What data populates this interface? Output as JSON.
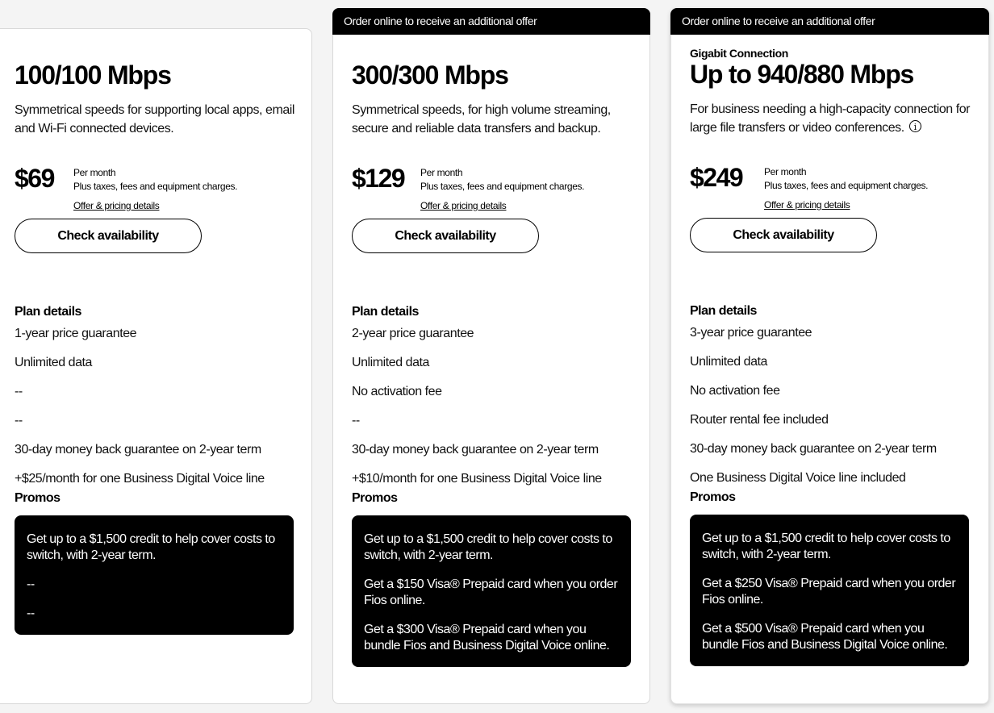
{
  "plans": [
    {
      "banner": "",
      "eyebrow": "",
      "speed": "100/100 Mbps",
      "description": "Symmetrical speeds for supporting local apps, email and Wi-Fi connected devices.",
      "price": "$69",
      "price_period": "Per month",
      "price_note": "Plus taxes, fees and equipment charges.",
      "offer_link": "Offer & pricing details",
      "cta": "Check availability",
      "details_title": "Plan details",
      "details": [
        "1-year price guarantee",
        "Unlimited data",
        "--",
        "--",
        "30-day money back guarantee on 2-year term",
        "+$25/month for one Business Digital Voice line"
      ],
      "promos_title": "Promos",
      "promos": [
        "Get up to a $1,500 credit to help cover costs to switch, with 2-year term.",
        "--",
        "--"
      ]
    },
    {
      "banner": "Order online to receive an additional offer",
      "eyebrow": "",
      "speed": "300/300 Mbps",
      "description": "Symmetrical speeds, for high volume streaming, secure and reliable data transfers and backup.",
      "price": "$129",
      "price_period": "Per month",
      "price_note": "Plus taxes, fees and equipment charges.",
      "offer_link": "Offer & pricing details",
      "cta": "Check availability",
      "details_title": "Plan details",
      "details": [
        "2-year price guarantee",
        "Unlimited data",
        "No activation fee",
        "--",
        "30-day money back guarantee on 2-year term",
        "+$10/month for one Business Digital Voice line"
      ],
      "promos_title": "Promos",
      "promos": [
        "Get up to a $1,500 credit to help cover costs to switch, with 2-year term.",
        "Get a $150 Visa® Prepaid card when you order Fios online.",
        "Get a $300 Visa® Prepaid card when you bundle Fios and Business Digital Voice online."
      ]
    },
    {
      "banner": "Order online to receive an additional offer",
      "eyebrow": "Gigabit Connection",
      "speed": "Up to 940/880 Mbps",
      "description": "For business needing a high-capacity connection for large file transfers or video conferences.",
      "info_icon": "i",
      "price": "$249",
      "price_period": "Per month",
      "price_note": "Plus taxes, fees and equipment charges.",
      "offer_link": "Offer & pricing details",
      "cta": "Check availability",
      "details_title": "Plan details",
      "details": [
        "3-year price guarantee",
        "Unlimited data",
        "No activation fee",
        "Router rental fee included",
        "30-day money back guarantee on 2-year term",
        "One Business Digital Voice line included"
      ],
      "promos_title": "Promos",
      "promos": [
        "Get up to a $1,500 credit to help cover costs to switch, with 2-year term.",
        "Get a $250 Visa® Prepaid card when you order Fios online.",
        "Get a $500 Visa® Prepaid card when you bundle Fios and Business Digital Voice online."
      ]
    }
  ]
}
